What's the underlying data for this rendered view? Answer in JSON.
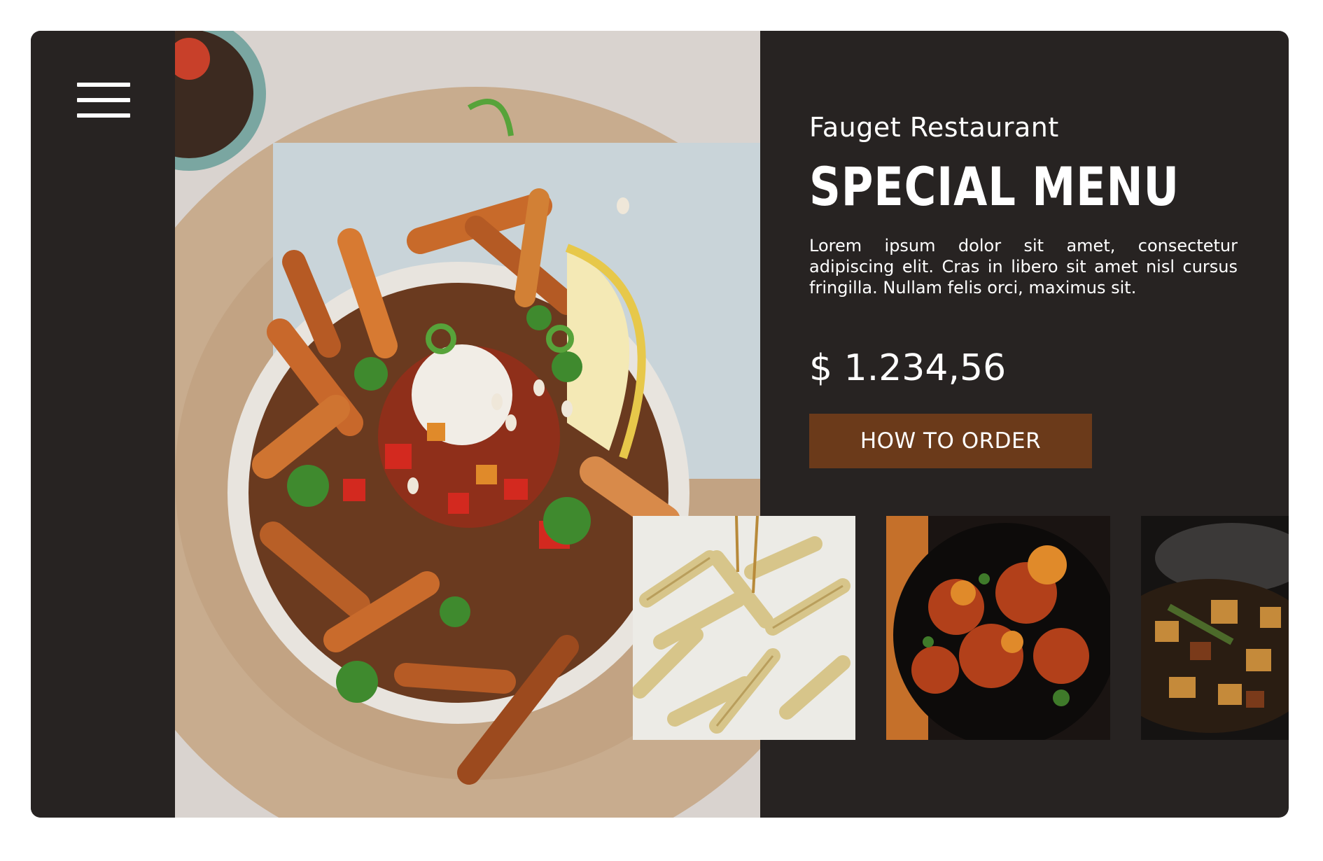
{
  "header": {
    "menu_icon": "hamburger-menu-icon"
  },
  "hero": {
    "image": "plate-of-roasted-sweet-potato-fries-with-salsa"
  },
  "info": {
    "brand": "Fauget Restaurant",
    "title": "SPECIAL MENU",
    "description": "Lorem ipsum dolor sit amet, consectetur adipiscing elit. Cras in libero sit amet nisl cursus fringilla. Nullam felis orci, maximus sit.",
    "price": "$ 1.234,56",
    "order_button": "HOW TO ORDER"
  },
  "thumbnails": [
    {
      "image": "penne-pasta-cream-sauce"
    },
    {
      "image": "glazed-chicken-in-black-bowl"
    },
    {
      "image": "steaming-stew-in-pan"
    }
  ],
  "colors": {
    "background": "#272322",
    "accent_button": "#6b3a1a",
    "text": "#ffffff"
  }
}
